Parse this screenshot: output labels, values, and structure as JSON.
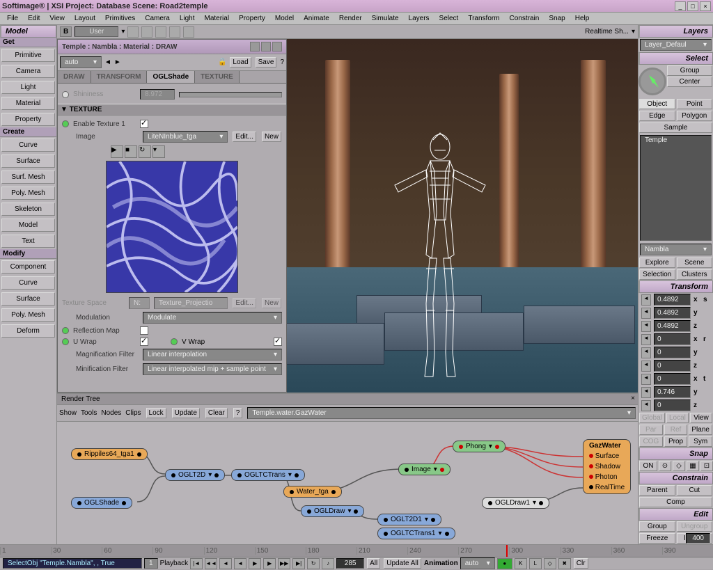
{
  "title": "Softimage® | XSI Project: Database     Scene: Road2temple",
  "menu": [
    "File",
    "Edit",
    "View",
    "Layout",
    "Primitives",
    "Camera",
    "Light",
    "Material",
    "Property",
    "Model",
    "Animate",
    "Render",
    "Simulate",
    "Layers",
    "Select",
    "Transform",
    "Constrain",
    "Snap",
    "Help"
  ],
  "left": {
    "header": "Model",
    "get": "Get",
    "get_items": [
      "Primitive",
      "Camera",
      "Light",
      "Material",
      "Property"
    ],
    "create": "Create",
    "create_items": [
      "Curve",
      "Surface",
      "Surf. Mesh",
      "Poly. Mesh",
      "Skeleton",
      "Model",
      "Text"
    ],
    "modify": "Modify",
    "modify_items": [
      "Component",
      "Curve",
      "Surface",
      "Poly. Mesh",
      "Deform"
    ]
  },
  "toptool": {
    "user": "User",
    "realtime": "Realtime Sh..."
  },
  "mat": {
    "title": "Temple : Nambla : Material : DRAW",
    "auto": "auto",
    "load": "Load",
    "save": "Save",
    "tabs": [
      "DRAW",
      "TRANSFORM",
      "OGLShade",
      "TEXTURE"
    ],
    "shininess": "Shininess",
    "shininess_val": "8.972",
    "section": "TEXTURE",
    "enable": "Enable Texture 1",
    "image": "Image",
    "image_val": "LiteNInblue_tga",
    "edit": "Edit...",
    "new": "New",
    "texspace": "Texture Space",
    "texspace_val": "N:",
    "texproj": "Texture_Projectio",
    "modulation": "Modulation",
    "modulation_val": "Modulate",
    "refl": "Reflection Map",
    "uwrap": "U Wrap",
    "vwrap": "V Wrap",
    "magf": "Magnification Filter",
    "magf_val": "Linear interpolation",
    "minf": "Minification Filter",
    "minf_val": "Linear interpolated mip + sample point"
  },
  "rt": {
    "title": "Render Tree",
    "tools": [
      "Show",
      "Tools",
      "Nodes",
      "Clips"
    ],
    "lock": "Lock",
    "update": "Update",
    "clear": "Clear",
    "path": "Temple.water.GazWater",
    "nodes": {
      "rip": "Rippiles64_tga1",
      "oglshade": "OGLShade",
      "oglt2d": "OGLT2D",
      "ogltctrans": "OGLTCTrans",
      "ogldraw": "OGLDraw",
      "water": "Water_tga",
      "image": "Image",
      "phong": "Phong",
      "oglt2d1": "OGLT2D1",
      "ogltctrans1": "OGLTCTrans1",
      "ogldraw1": "OGLDraw1",
      "gaz": "GazWater",
      "surf": "Surface",
      "shadow": "Shadow",
      "photon": "Photon",
      "realtime": "RealTime"
    }
  },
  "right": {
    "layers": "Layers",
    "layer_default": "Layer_Defaul",
    "select": "Select",
    "group": "Group",
    "center": "Center",
    "object": "Object",
    "point": "Point",
    "edge": "Edge",
    "polygon": "Polygon",
    "sample": "Sample",
    "obj1": "Temple",
    "obj2": "Nambla",
    "explore": "Explore",
    "scene": "Scene",
    "selection": "Selection",
    "clusters": "Clusters",
    "transform": "Transform",
    "s": "s",
    "r": "r",
    "t": "t",
    "sv": [
      "0.4892",
      "0.4892",
      "0.4892"
    ],
    "rv": [
      "0",
      "0",
      "0"
    ],
    "tv": [
      "0",
      "0.746",
      "0"
    ],
    "global": "Global",
    "local": "Local",
    "view": "View",
    "par": "Par",
    "ref": "Ref",
    "plane": "Plane",
    "cog": "COG",
    "prop": "Prop",
    "sym": "Sym",
    "snap": "Snap",
    "on": "ON",
    "constrain": "Constrain",
    "parent": "Parent",
    "cut": "Cut",
    "comp": "Comp",
    "edit": "Edit",
    "group2": "Group",
    "ungroup": "Ungroup",
    "freeze": "Freeze",
    "immed": "Immed"
  },
  "timeline": {
    "status": "SelectObj \"Temple.Nambla\", , True",
    "playback": "Playback",
    "frame": "285",
    "all": "All",
    "update_all": "Update All",
    "animation": "Animation",
    "auto": "auto",
    "clr": "Clr",
    "end": "400",
    "ticks": [
      "1",
      "30",
      "60",
      "90",
      "120",
      "150",
      "180",
      "210",
      "240",
      "270",
      "300",
      "330",
      "360",
      "390"
    ],
    "start": "1"
  }
}
